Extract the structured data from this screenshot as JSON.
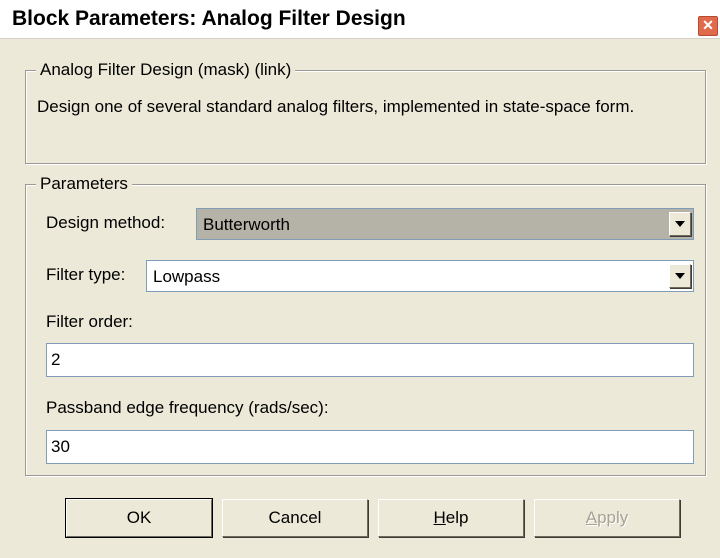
{
  "window": {
    "title": "Block Parameters: Analog Filter Design",
    "close_glyph": "✕"
  },
  "mask": {
    "legend": "Analog Filter Design (mask) (link)",
    "description": "Design one of several standard analog filters, implemented in state-space form."
  },
  "parameters": {
    "legend": "Parameters",
    "design_method": {
      "label": "Design method:",
      "value": "Butterworth"
    },
    "filter_type": {
      "label": "Filter type:",
      "value": "Lowpass"
    },
    "filter_order": {
      "label": "Filter order:",
      "value": "2"
    },
    "passband": {
      "label": "Passband edge frequency (rads/sec):",
      "value": "30"
    }
  },
  "buttons": {
    "ok": "OK",
    "cancel": "Cancel",
    "help_mnemonic": "H",
    "help_rest": "elp",
    "apply_mnemonic": "A",
    "apply_rest": "pply"
  },
  "colors": {
    "dialog_bg": "#ece9d8",
    "disabled_text": "#a6a394",
    "locked_field_bg": "#b5b2a8"
  }
}
